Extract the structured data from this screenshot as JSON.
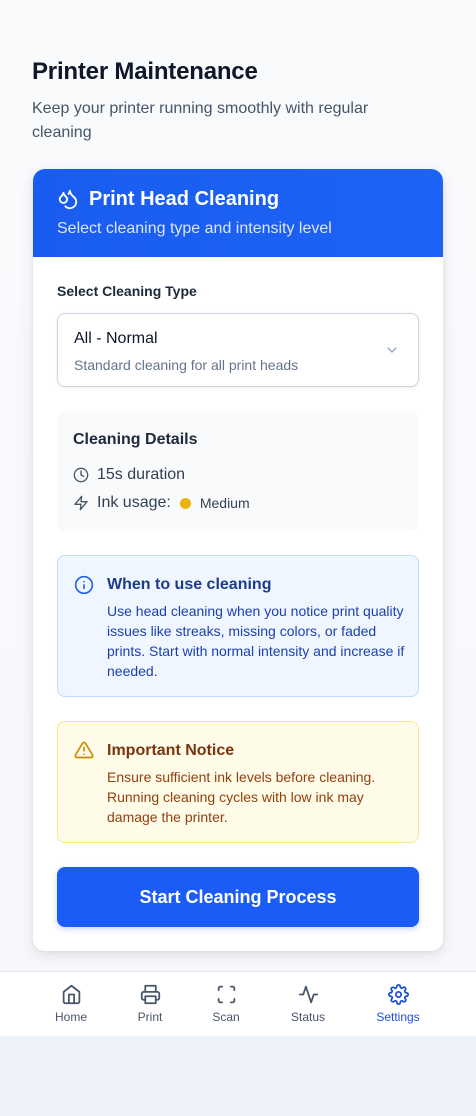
{
  "page": {
    "title": "Printer Maintenance",
    "subtitle": "Keep your printer running smoothly with regular cleaning"
  },
  "card": {
    "header": {
      "icon": "droplets-icon",
      "title": "Print Head Cleaning",
      "subtitle": "Select cleaning type and intensity level"
    },
    "cleaning_type": {
      "label": "Select Cleaning Type",
      "selected_value": "All - Normal",
      "selected_description": "Standard cleaning for all print heads"
    },
    "details": {
      "title": "Cleaning Details",
      "duration": "15s duration",
      "ink_usage_label": "Ink usage:",
      "ink_usage_level": "Medium",
      "ink_usage_color": "#eab308"
    },
    "info": {
      "title": "When to use cleaning",
      "text": "Use head cleaning when you notice print quality issues like streaks, missing colors, or faded prints. Start with normal intensity and increase if needed."
    },
    "warning": {
      "title": "Important Notice",
      "text": "Ensure sufficient ink levels before cleaning. Running cleaning cycles with low ink may damage the printer."
    },
    "start_button_label": "Start Cleaning Process"
  },
  "nav": {
    "items": [
      {
        "label": "Home",
        "icon": "home-icon"
      },
      {
        "label": "Print",
        "icon": "printer-icon"
      },
      {
        "label": "Scan",
        "icon": "scan-icon"
      },
      {
        "label": "Status",
        "icon": "activity-icon"
      },
      {
        "label": "Settings",
        "icon": "gear-icon"
      }
    ],
    "active": "Settings"
  },
  "colors": {
    "accent": "#1a5cf5",
    "info_bg": "#eff6ff",
    "warning_bg": "#fefce8"
  }
}
